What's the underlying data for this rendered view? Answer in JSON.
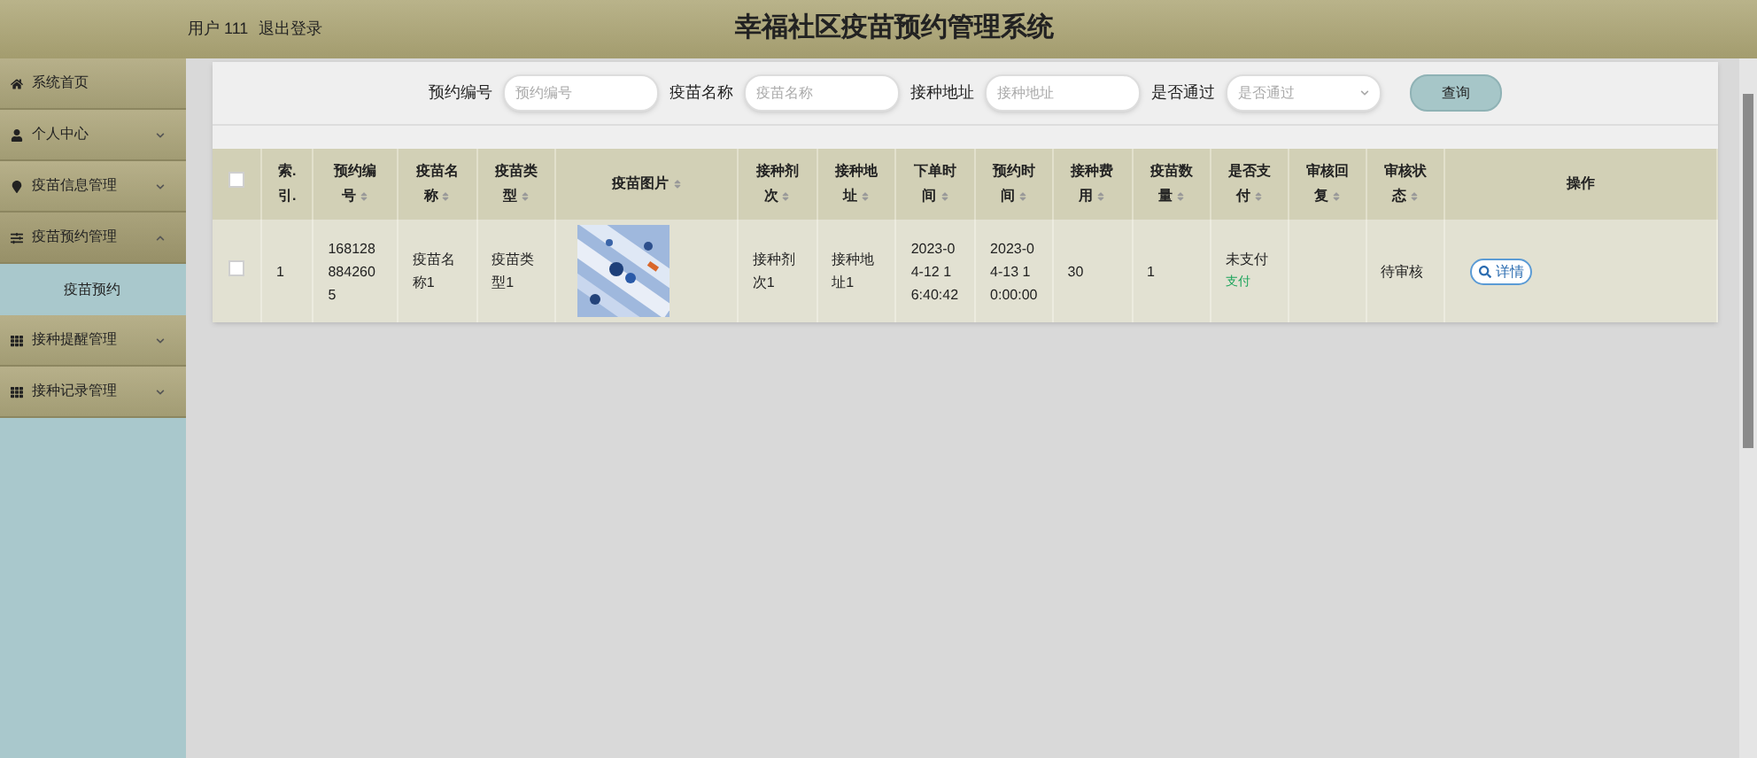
{
  "header": {
    "user": "用户 111",
    "logout": "退出登录",
    "title": "幸福社区疫苗预约管理系统"
  },
  "sidebar": {
    "items": [
      {
        "label": "系统首页"
      },
      {
        "label": "个人中心",
        "expanded": false
      },
      {
        "label": "疫苗信息管理",
        "expanded": false
      },
      {
        "label": "疫苗预约管理",
        "expanded": true,
        "children": [
          {
            "label": "疫苗预约",
            "selected": true
          }
        ]
      },
      {
        "label": "接种提醒管理",
        "expanded": false
      },
      {
        "label": "接种记录管理",
        "expanded": false
      }
    ]
  },
  "search": {
    "fields": [
      {
        "kind": "input",
        "label": "预约编号",
        "placeholder": "预约编号"
      },
      {
        "kind": "input",
        "label": "疫苗名称",
        "placeholder": "疫苗名称"
      },
      {
        "kind": "input",
        "label": "接种地址",
        "placeholder": "接种地址"
      },
      {
        "kind": "select",
        "label": "是否通过",
        "placeholder": "是否通过"
      }
    ],
    "button": "查询"
  },
  "table": {
    "columns": [
      {
        "kind": "checkbox",
        "checked": false
      },
      {
        "kind": "text",
        "label": "索.引.",
        "sortable": false
      },
      {
        "kind": "text",
        "label": "预约编号",
        "sortable": true
      },
      {
        "kind": "text",
        "label": "疫苗名称",
        "sortable": true
      },
      {
        "kind": "text",
        "label": "疫苗类型",
        "sortable": true
      },
      {
        "kind": "text",
        "label": "疫苗图片",
        "sortable": true
      },
      {
        "kind": "text",
        "label": "接种剂次",
        "sortable": true
      },
      {
        "kind": "text",
        "label": "接种地址",
        "sortable": true
      },
      {
        "kind": "text",
        "label": "下单时间",
        "sortable": true
      },
      {
        "kind": "text",
        "label": "预约时间",
        "sortable": true
      },
      {
        "kind": "text",
        "label": "接种费用",
        "sortable": true
      },
      {
        "kind": "text",
        "label": "疫苗数量",
        "sortable": true
      },
      {
        "kind": "text",
        "label": "是否支付",
        "sortable": true
      },
      {
        "kind": "text",
        "label": "审核回复",
        "sortable": true
      },
      {
        "kind": "text",
        "label": "审核状态",
        "sortable": true
      },
      {
        "kind": "text",
        "label": "操作",
        "sortable": false
      }
    ],
    "rows": [
      {
        "checked": false,
        "cells": [
          {
            "kind": "checkbox"
          },
          {
            "kind": "text",
            "text": "1"
          },
          {
            "kind": "text",
            "text": "1681288842605"
          },
          {
            "kind": "text",
            "text": "疫苗名称1"
          },
          {
            "kind": "text",
            "text": "疫苗类型1"
          },
          {
            "kind": "picture"
          },
          {
            "kind": "text",
            "text": "接种剂次1"
          },
          {
            "kind": "text",
            "text": "接种地址1"
          },
          {
            "kind": "text",
            "text": "2023-04-12 16:40:42"
          },
          {
            "kind": "text",
            "text": "2023-04-13 10:00:00"
          },
          {
            "kind": "text",
            "text": "30"
          },
          {
            "kind": "text",
            "text": "1"
          },
          {
            "kind": "payment",
            "text": "未支付",
            "link": "支付"
          },
          {
            "kind": "empty"
          },
          {
            "kind": "text",
            "text": "待审核"
          },
          {
            "kind": "action",
            "button": "详情"
          }
        ]
      }
    ]
  }
}
